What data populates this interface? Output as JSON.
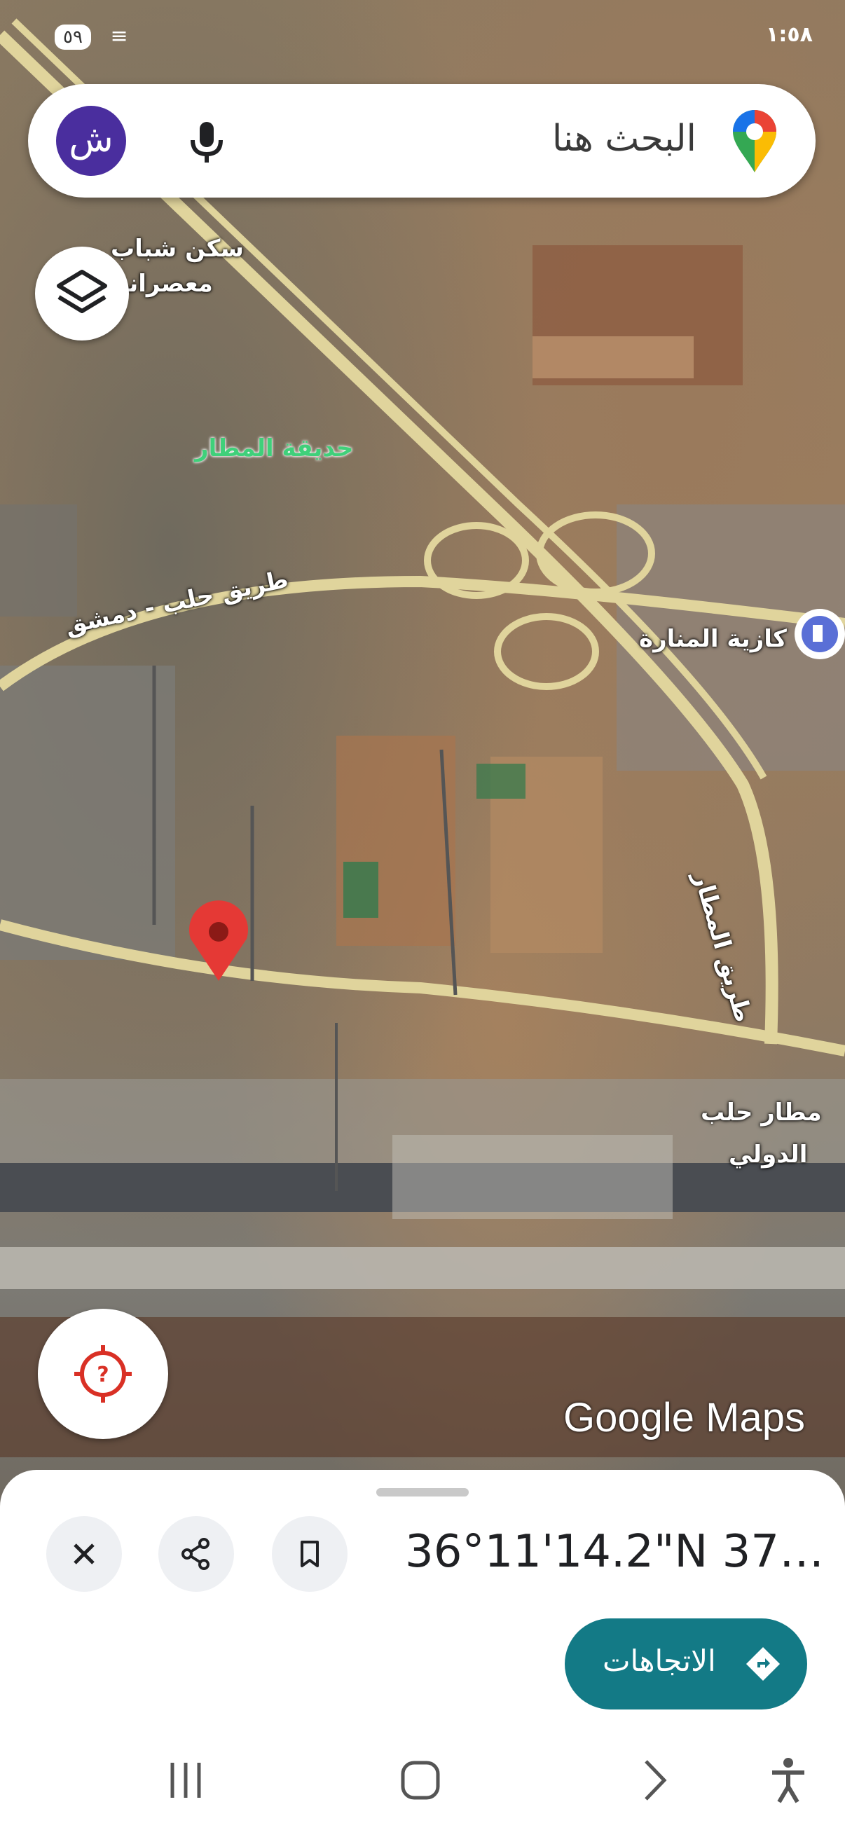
{
  "status_bar": {
    "time": "١:٥٨",
    "badge": "٥٩"
  },
  "search": {
    "placeholder": "البحث هنا",
    "avatar_letter": "ش"
  },
  "map_labels": {
    "youth_housing": "سكن شباب",
    "masraniyeh": "معصرانية",
    "airport_park": "حديقة المطار",
    "aleppo_damascus_road": "طريق حلب - دمشق",
    "manara_station": "كازية المنارة",
    "airport_road": "طريق المطار",
    "aleppo_airport_line1": "مطار حلب",
    "aleppo_airport_line2": "الدولي"
  },
  "watermark": "Google Maps",
  "place": {
    "coordinates": "36°11'14.2\"N 37°1..."
  },
  "buttons": {
    "directions": "الاتجاهات"
  },
  "icons": {
    "layers": "layers-icon",
    "mic": "mic-icon",
    "location": "location-question-icon",
    "close": "close-icon",
    "share": "share-icon",
    "save": "bookmark-icon",
    "directions": "directions-icon",
    "fuel": "fuel-station-icon",
    "pin": "map-pin-icon"
  },
  "colors": {
    "accent": "#137a86",
    "avatar": "#4a2e9e",
    "pin": "#e53935",
    "road": "#e0d49c"
  }
}
